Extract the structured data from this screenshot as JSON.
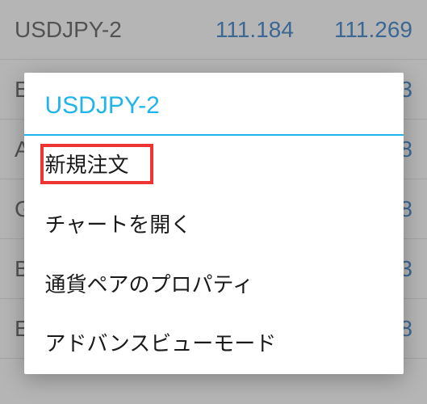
{
  "background": {
    "rows": [
      {
        "symbol": "USDJPY-2",
        "bid": "111.184",
        "ask": "111.269"
      },
      {
        "symbol": "E",
        "bid": "",
        "ask": "3"
      },
      {
        "symbol": "A",
        "bid": "",
        "ask": "8"
      },
      {
        "symbol": "G",
        "bid": "",
        "ask": "8"
      },
      {
        "symbol": "B",
        "bid": "",
        "ask": "3"
      },
      {
        "symbol": "E",
        "bid": "",
        "ask": "8"
      }
    ]
  },
  "modal": {
    "title": "USDJPY-2",
    "items": [
      {
        "label": "新規注文",
        "highlighted": true
      },
      {
        "label": "チャートを開く",
        "highlighted": false
      },
      {
        "label": "通貨ペアのプロパティ",
        "highlighted": false
      },
      {
        "label": "アドバンスビューモード",
        "highlighted": false
      }
    ]
  }
}
